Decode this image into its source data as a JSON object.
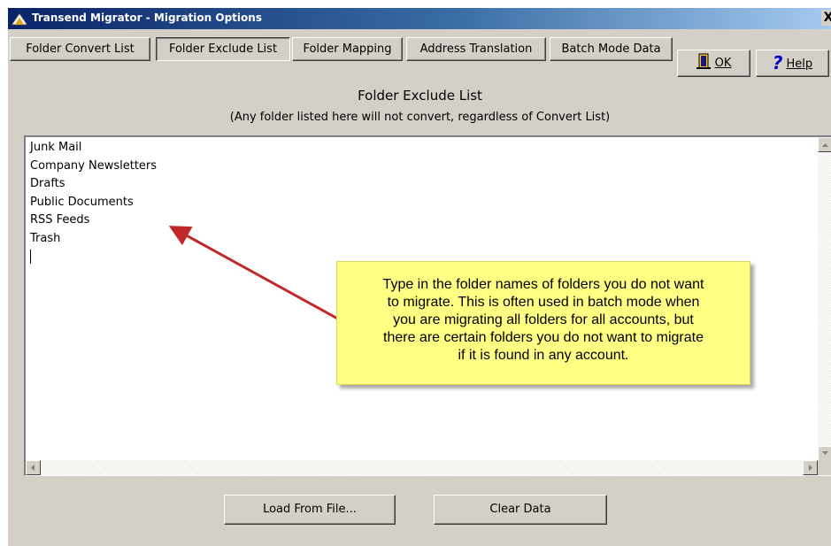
{
  "window": {
    "title": "Transend Migrator - Migration Options",
    "close_label": "X"
  },
  "tabs": [
    {
      "label": "Folder Convert List",
      "active": false
    },
    {
      "label": "Folder Exclude List",
      "active": true
    },
    {
      "label": "Folder Mapping",
      "active": false
    },
    {
      "label": "Address Translation",
      "active": false
    },
    {
      "label": "Batch Mode Data",
      "active": false
    }
  ],
  "toolbar": {
    "ok_label": "OK",
    "help_label": "Help"
  },
  "page": {
    "heading": "Folder Exclude List",
    "subheading": "(Any folder listed here will not convert, regardless of Convert List)"
  },
  "exclude_list": {
    "lines": [
      "Junk Mail",
      "Company Newsletters",
      "Drafts",
      "Public Documents",
      "RSS Feeds",
      "Trash"
    ]
  },
  "callout": {
    "text": "Type in the folder names of folders you do not want\nto migrate. This is often used in batch mode when\nyou are migrating all folders for all accounts, but\nthere are certain folders you do not want to migrate\nif it is found in any account.",
    "color": "#ffff84",
    "arrow_color": "#c0282a"
  },
  "buttons": {
    "load_label": "Load From File...",
    "clear_label": "Clear Data"
  },
  "icons": [
    "app-icon",
    "ok-icon",
    "help-icon",
    "close-icon",
    "scroll-up-icon",
    "scroll-down-icon",
    "scroll-left-icon",
    "scroll-right-icon"
  ]
}
